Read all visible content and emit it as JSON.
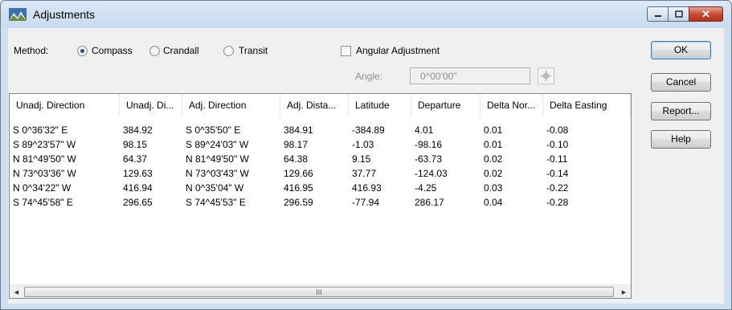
{
  "window": {
    "title": "Adjustments"
  },
  "method": {
    "label": "Method:",
    "options": [
      {
        "label": "Compass",
        "checked": true
      },
      {
        "label": "Crandall",
        "checked": false
      },
      {
        "label": "Transit",
        "checked": false
      }
    ]
  },
  "angular": {
    "label": "Angular Adjustment",
    "checked": false
  },
  "angle": {
    "label": "Angle:",
    "value": "0^00'00\""
  },
  "buttons": {
    "ok": "OK",
    "cancel": "Cancel",
    "report": "Report...",
    "help": "Help"
  },
  "table": {
    "columns": [
      "Unadj. Direction",
      "Unadj. Di...",
      "Adj. Direction",
      "Adj. Dista...",
      "Latitude",
      "Departure",
      "Delta Nor...",
      "Delta Easting"
    ],
    "rows": [
      [
        "S  0^36'32\" E",
        "384.92",
        "S  0^35'50\" E",
        "384.91",
        "-384.89",
        "4.01",
        "0.01",
        "-0.08"
      ],
      [
        "S 89^23'57\" W",
        "98.15",
        "S 89^24'03\" W",
        "98.17",
        "-1.03",
        "-98.16",
        "0.01",
        "-0.10"
      ],
      [
        "N 81^49'50\" W",
        "64.37",
        "N 81^49'50\" W",
        "64.38",
        "9.15",
        "-63.73",
        "0.02",
        "-0.11"
      ],
      [
        "N 73^03'36\" W",
        "129.63",
        "N 73^03'43\" W",
        "129.66",
        "37.77",
        "-124.03",
        "0.02",
        "-0.14"
      ],
      [
        "N  0^34'22\" W",
        "416.94",
        "N  0^35'04\" W",
        "416.95",
        "416.93",
        "-4.25",
        "0.03",
        "-0.22"
      ],
      [
        "S 74^45'58\" E",
        "296.65",
        "S 74^45'53\" E",
        "296.59",
        "-77.94",
        "286.17",
        "0.04",
        "-0.28"
      ]
    ]
  },
  "scrollbar": {
    "thumb_glyph": "III",
    "left_arrow": "◀",
    "right_arrow": "▶"
  },
  "caption": {
    "minimize": "▬",
    "maximize": "▢",
    "close": "✕"
  }
}
